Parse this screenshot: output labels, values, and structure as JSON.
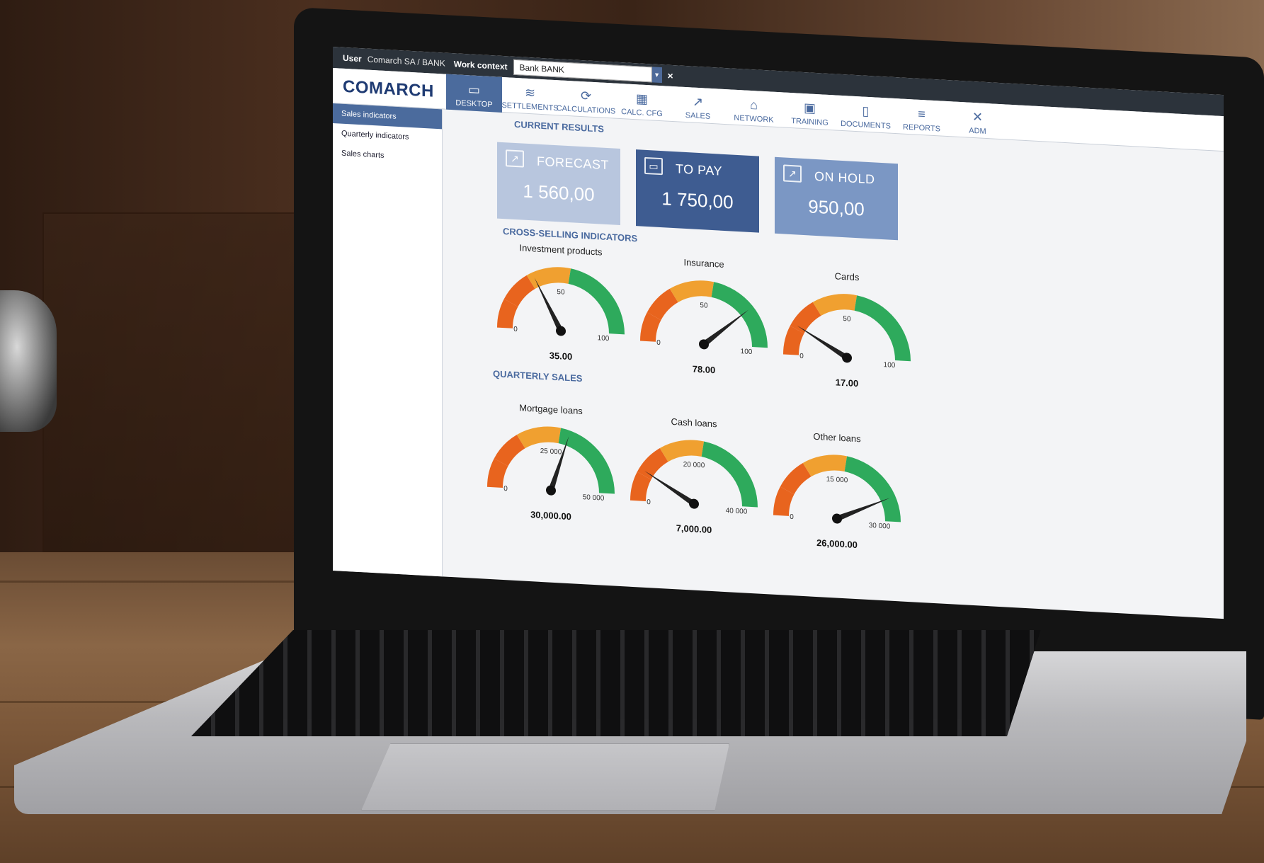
{
  "topbar": {
    "user_label": "User",
    "user_value": "Comarch SA / BANK",
    "context_label": "Work context",
    "context_value": "Bank BANK",
    "close_symbol": "×"
  },
  "logo": "COMARCH",
  "nav": [
    {
      "label": "DESKTOP",
      "icon": "monitor-icon",
      "glyph": "▭",
      "active": true
    },
    {
      "label": "SETTLEMENTS",
      "icon": "coins-icon",
      "glyph": "≋",
      "active": false
    },
    {
      "label": "CALCULATIONS",
      "icon": "refresh-coin-icon",
      "glyph": "⟳",
      "active": false
    },
    {
      "label": "CALC. CFG",
      "icon": "calculator-icon",
      "glyph": "▦",
      "active": false
    },
    {
      "label": "SALES",
      "icon": "trend-icon",
      "glyph": "↗",
      "active": false
    },
    {
      "label": "NETWORK",
      "icon": "network-icon",
      "glyph": "⌂",
      "active": false
    },
    {
      "label": "TRAINING",
      "icon": "presentation-icon",
      "glyph": "▣",
      "active": false
    },
    {
      "label": "DOCUMENTS",
      "icon": "book-icon",
      "glyph": "▯",
      "active": false
    },
    {
      "label": "REPORTS",
      "icon": "stack-icon",
      "glyph": "≡",
      "active": false
    },
    {
      "label": "ADM",
      "icon": "tools-icon",
      "glyph": "✕",
      "active": false
    }
  ],
  "sidebar": [
    {
      "label": "Sales indicators",
      "active": true
    },
    {
      "label": "Quarterly indicators",
      "active": false
    },
    {
      "label": "Sales charts",
      "active": false
    }
  ],
  "sections": {
    "current_results": "CURRENT RESULTS",
    "cross_selling": "CROSS-SELLING INDICATORS",
    "quarterly_sales": "QUARTERLY SALES"
  },
  "cards": [
    {
      "title": "FORECAST",
      "value": "1 560,00",
      "color": "#b8c6de",
      "icon": "chart-icon"
    },
    {
      "title": "TO PAY",
      "value": "1 750,00",
      "color": "#3e5c91",
      "icon": "wallet-icon"
    },
    {
      "title": "ON HOLD",
      "value": "950,00",
      "color": "#7b97c4",
      "icon": "chart-icon"
    }
  ],
  "gauges_cross": [
    {
      "title": "Investment products",
      "min_label": "0",
      "mid_label": "50",
      "max_label": "100",
      "min": 0,
      "max": 100,
      "value": 35,
      "value_label": "35.00"
    },
    {
      "title": "Insurance",
      "min_label": "0",
      "mid_label": "50",
      "max_label": "100",
      "min": 0,
      "max": 100,
      "value": 78,
      "value_label": "78.00"
    },
    {
      "title": "Cards",
      "min_label": "0",
      "mid_label": "50",
      "max_label": "100",
      "min": 0,
      "max": 100,
      "value": 17,
      "value_label": "17.00"
    }
  ],
  "gauges_quarterly": [
    {
      "title": "Mortgage loans",
      "min_label": "0",
      "mid_label": "25 000",
      "max_label": "50 000",
      "min": 0,
      "max": 50000,
      "value": 30000,
      "value_label": "30,000.00"
    },
    {
      "title": "Cash loans",
      "min_label": "0",
      "mid_label": "20 000",
      "max_label": "40 000",
      "min": 0,
      "max": 40000,
      "value": 7000,
      "value_label": "7,000.00"
    },
    {
      "title": "Other loans",
      "min_label": "0",
      "mid_label": "15 000",
      "max_label": "30 000",
      "min": 0,
      "max": 30000,
      "value": 26000,
      "value_label": "26,000.00"
    }
  ],
  "colors": {
    "accent": "#4b6b9d",
    "gauge_red": "#e8641e",
    "gauge_orange": "#f0a030",
    "gauge_green": "#2eaa5c",
    "gauge_lightgreen": "#6fae4a"
  }
}
